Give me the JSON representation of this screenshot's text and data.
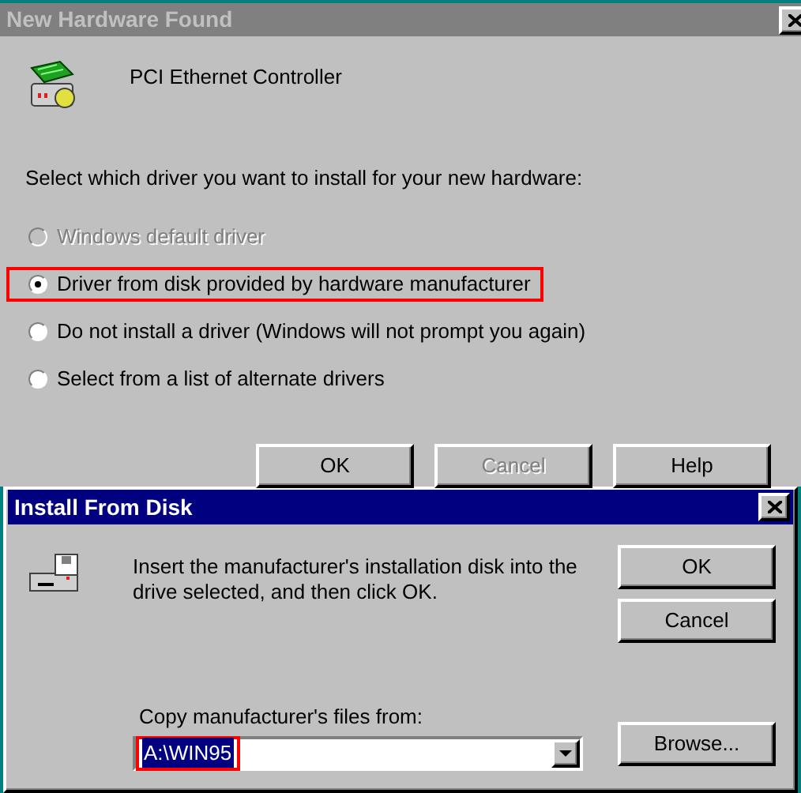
{
  "window": {
    "title": "New Hardware Found",
    "active": false
  },
  "device": {
    "name": "PCI Ethernet Controller"
  },
  "prompt": "Select which driver you want to install for your new hardware:",
  "options": [
    {
      "label": "Windows default driver",
      "selected": false,
      "disabled": true,
      "highlighted": false
    },
    {
      "label": "Driver from disk provided by hardware manufacturer",
      "selected": true,
      "disabled": false,
      "highlighted": true
    },
    {
      "label": "Do not install a driver (Windows will not prompt you again)",
      "selected": false,
      "disabled": false,
      "highlighted": false
    },
    {
      "label": "Select from a list of alternate drivers",
      "selected": false,
      "disabled": false,
      "highlighted": false
    }
  ],
  "buttons": [
    {
      "label": "OK",
      "disabled": false
    },
    {
      "label": "Cancel",
      "disabled": true
    },
    {
      "label": "Help",
      "disabled": false
    }
  ],
  "install_dialog": {
    "title": "Install From Disk",
    "active": true,
    "message": "Insert the manufacturer's installation disk into the drive selected, and then click OK.",
    "buttons": [
      {
        "label": "OK"
      },
      {
        "label": "Cancel"
      }
    ],
    "field_label": "Copy manufacturer's files from:",
    "field_value": "A:\\WIN95",
    "field_highlighted": true,
    "browse_button": "Browse..."
  }
}
